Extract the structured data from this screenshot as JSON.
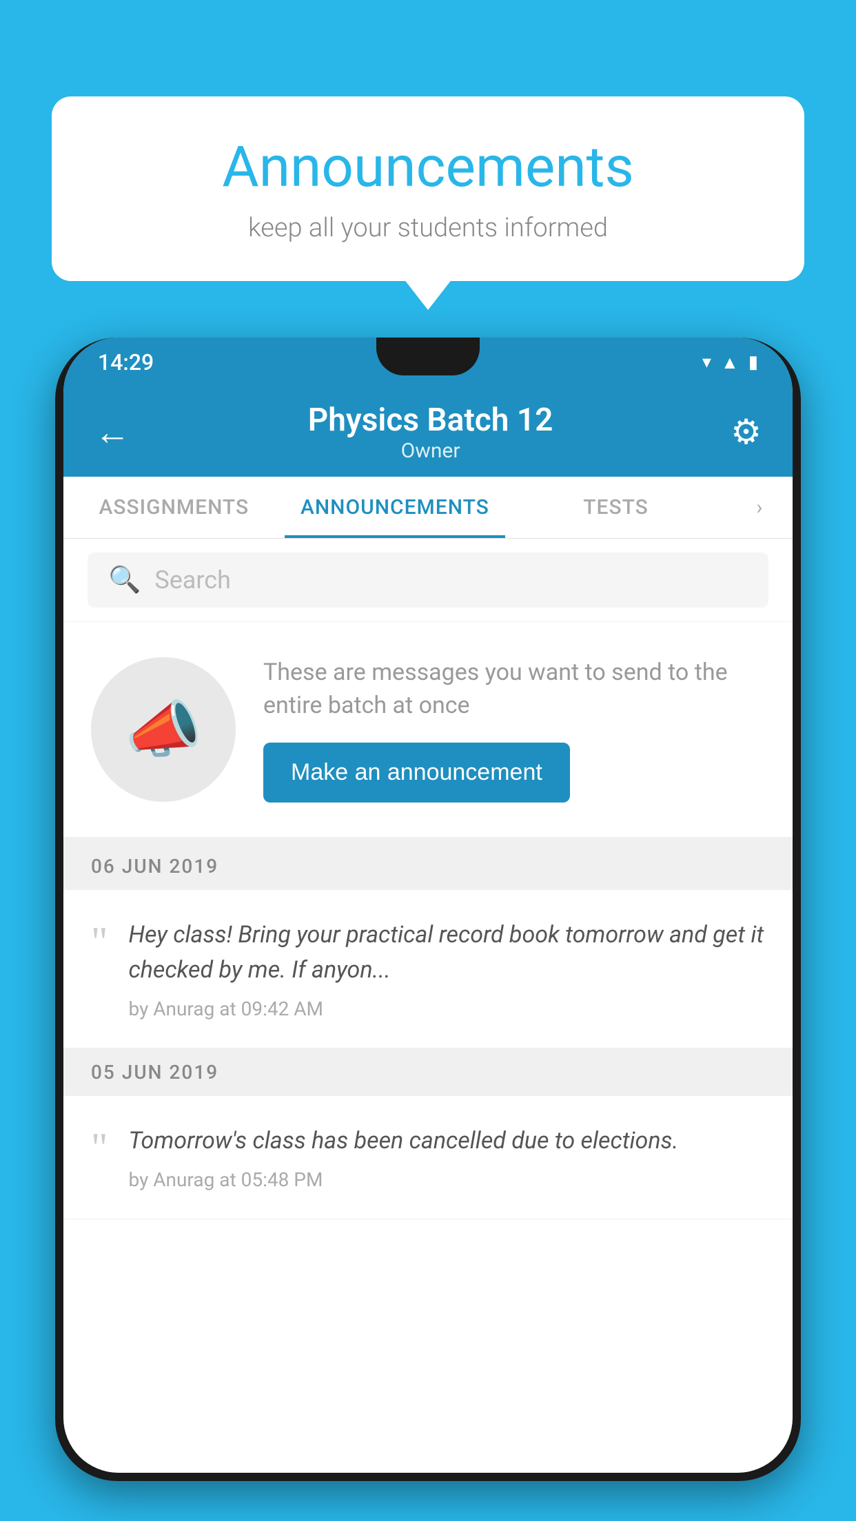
{
  "background_color": "#29b6e8",
  "speech_bubble": {
    "title": "Announcements",
    "subtitle": "keep all your students informed"
  },
  "phone": {
    "status_bar": {
      "time": "14:29"
    },
    "header": {
      "title": "Physics Batch 12",
      "subtitle": "Owner",
      "back_label": "←",
      "settings_label": "⚙"
    },
    "tabs": [
      {
        "label": "ASSIGNMENTS",
        "active": false
      },
      {
        "label": "ANNOUNCEMENTS",
        "active": true
      },
      {
        "label": "TESTS",
        "active": false
      }
    ],
    "tabs_more": "›",
    "search": {
      "placeholder": "Search"
    },
    "announcement_intro": {
      "description": "These are messages you want to send to the entire batch at once",
      "button_label": "Make an announcement"
    },
    "announcement_groups": [
      {
        "date": "06  JUN  2019",
        "items": [
          {
            "text": "Hey class! Bring your practical record book tomorrow and get it checked by me. If anyon...",
            "meta": "by Anurag at 09:42 AM"
          }
        ]
      },
      {
        "date": "05  JUN  2019",
        "items": [
          {
            "text": "Tomorrow's class has been cancelled due to elections.",
            "meta": "by Anurag at 05:48 PM"
          }
        ]
      }
    ]
  }
}
